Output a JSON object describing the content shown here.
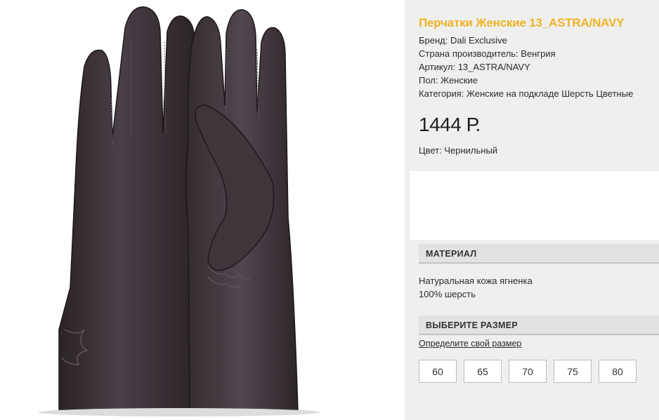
{
  "product": {
    "title": "Перчатки Женские 13_ASTRA/NAVY",
    "specs": [
      {
        "text": "Бренд: Dali Exclusive"
      },
      {
        "text": "Страна производитель: Венгрия"
      },
      {
        "text": "Артикул: 13_ASTRA/NAVY"
      },
      {
        "text": "Пол: Женские"
      },
      {
        "text": "Категория: Женские на подкладе Шерсть Цветные"
      }
    ],
    "price": "1444 Р.",
    "color": "Цвет: Чернильный"
  },
  "material": {
    "header": "МАТЕРИАЛ",
    "lines": [
      "Натуральная кожа ягненка",
      "100% шерсть"
    ]
  },
  "size": {
    "header": "ВЫБЕРИТЕ РАЗМЕР",
    "guide_link": "Определите свой размер",
    "options": [
      "60",
      "65",
      "70",
      "75",
      "80"
    ]
  },
  "colors": {
    "title": "#f0b323",
    "panel_bg": "#efefef",
    "glove": "#3b3338"
  },
  "image": {
    "icon": "product-photo-gloves"
  }
}
